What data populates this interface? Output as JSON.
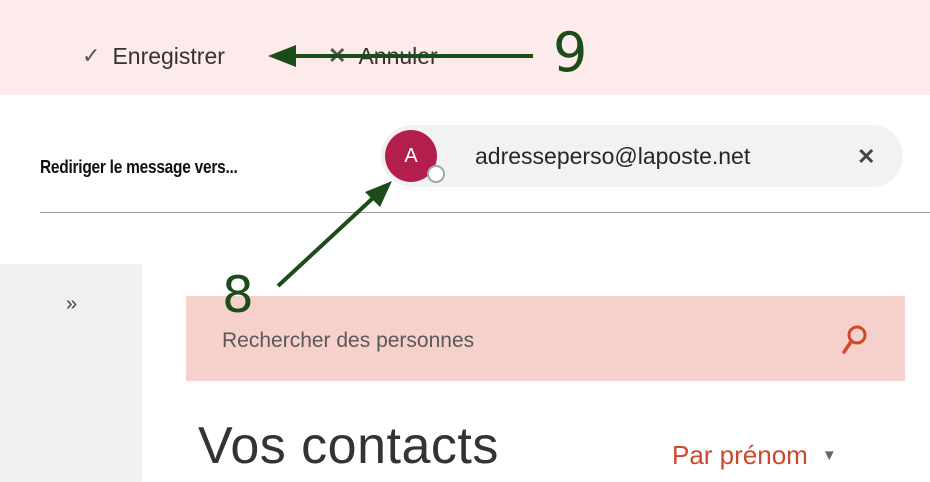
{
  "toolbar": {
    "save_label": "Enregistrer",
    "cancel_label": "Annuler"
  },
  "redirect": {
    "label": "Rediriger le message vers...",
    "recipient": {
      "initial": "A",
      "email": "adresseperso@laposte.net",
      "avatar_color": "#b31e4c"
    }
  },
  "sidebar": {
    "expand_glyph": "»"
  },
  "search": {
    "placeholder": "Rechercher des personnes"
  },
  "contacts": {
    "title": "Vos contacts",
    "sort_label": "Par prénom"
  },
  "annotations": {
    "step_8": "8",
    "step_9": "9",
    "color": "#1a4d1a"
  },
  "colors": {
    "toolbar_bg": "#fcebea",
    "search_bg": "#f6d1cc",
    "accent": "#d0482a"
  },
  "icons": [
    "checkmark-icon",
    "close-icon",
    "search-icon",
    "expand-icon",
    "caret-down-icon"
  ]
}
